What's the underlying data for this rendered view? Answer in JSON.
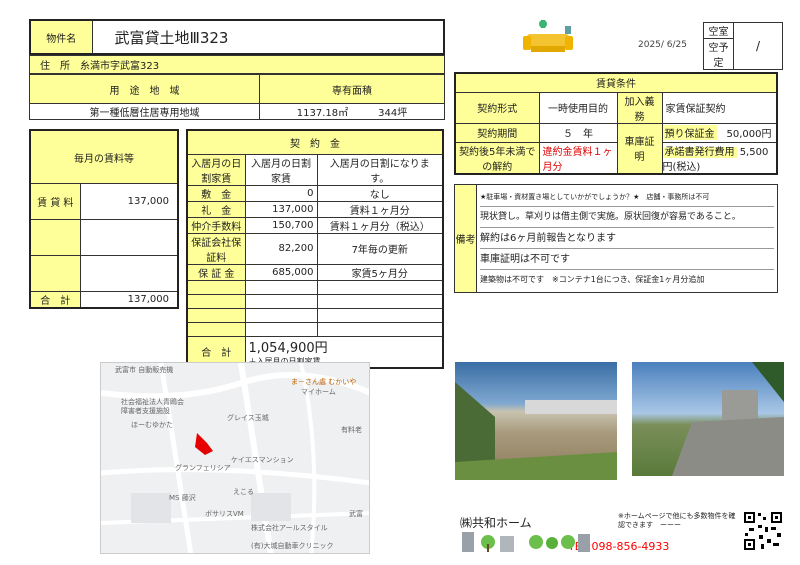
{
  "property": {
    "name_label": "物件名",
    "name": "武富貸土地Ⅲ323",
    "address_label": "住　所",
    "address": "糸満市字武富323",
    "usage_label": "用　途　地　域",
    "usage": "第一種低層住居専用地域",
    "area_label": "専有面積",
    "area_m2": "1137.18㎡",
    "area_tsubo": "344坪"
  },
  "status": {
    "vacant": "空室",
    "planned": "空予定",
    "date": "2025/ 6/25",
    "mark": "/"
  },
  "monthly": {
    "title": "毎月の賃料等",
    "rent_label": "賃 貸 料",
    "rent": "137,000",
    "total_label": "合　計",
    "total": "137,000"
  },
  "contract": {
    "title": "契　約　金",
    "rows": [
      {
        "label": "入居月の日割家賃",
        "amount": "入居月の日割家賃",
        "note": "入居月の日割になります。"
      },
      {
        "label": "敷　金",
        "amount": "0",
        "note": "なし"
      },
      {
        "label": "礼　金",
        "amount": "137,000",
        "note": "賃料１ヶ月分"
      },
      {
        "label": "仲介手数料",
        "amount": "150,700",
        "note": "賃料１ヶ月分（税込）"
      },
      {
        "label": "保証会社保証料",
        "amount": "82,200",
        "note": "7年毎の更新"
      },
      {
        "label": "保 証 金",
        "amount": "685,000",
        "note": "家賃5ヶ月分"
      }
    ],
    "total_label": "合　計",
    "total": "1,054,900円",
    "total_note": "＋入居月の日割家賃"
  },
  "conditions": {
    "title": "賃貸条件",
    "type_label": "契約形式",
    "type": "一時使用目的",
    "insurance_label": "加入義務",
    "insurance": "家賃保証契約",
    "period_label": "契約期間",
    "period": "５　年",
    "vehicle_label": "車庫証明",
    "deposit_label": "預り保証金",
    "deposit": "50,000円",
    "penalty_label": "契約後5年未満での解約",
    "penalty": "違約金賃料１ヶ月分",
    "cert_label": "承諾書発行費用",
    "cert": "5,500円(税込)"
  },
  "remarks": {
    "label": "備考",
    "lines": [
      "★駐車場・資材置き場としていかがでしょうか？★　店舗・事務所は不可",
      "現状貸し。草刈りは借主側で実施。原状回復が容易であること。",
      "解約は6ヶ月前報告となります",
      "車庫証明は不可です",
      "建築物は不可です　※コンテナ1台につき、保証金1ヶ月分追加"
    ]
  },
  "map": {
    "labels": [
      "武富市 自動販売機",
      "社会福祉法人青鴎会",
      "障害者支援施設",
      "ほーむゆかた",
      "グレイス玉城",
      "ケイエスマンション",
      "グランフェリシア",
      "えこる",
      "MS 藤沢",
      "ボサリスVM",
      "株式会社アールスタイル",
      "(有)大城自動車クリニック",
      "ま－さん處 むかいや",
      "マイホーム",
      "有料老",
      "武富"
    ]
  },
  "footer": {
    "company": "㈱共和ホーム",
    "note": "※ホームページで他にも多数物件を確認できます　ーーー",
    "tel": "TEL:098-856-4933"
  },
  "colors": {
    "yellow": "#ffff99",
    "tel": "#ff0000",
    "marker": "#e60000"
  }
}
